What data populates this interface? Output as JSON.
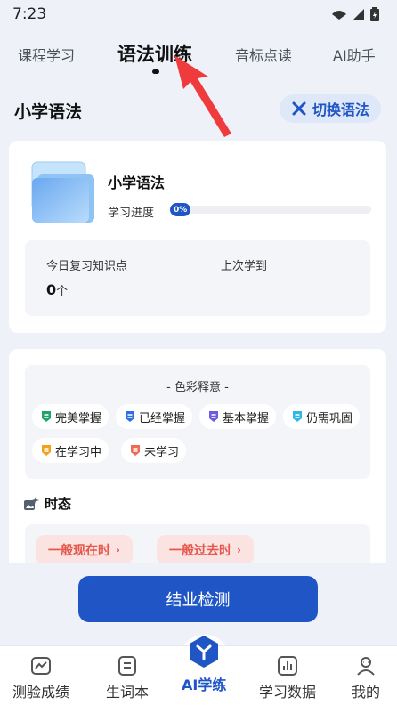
{
  "status_bar": {
    "time": "7:23"
  },
  "top_tabs": [
    {
      "label": "课程学习"
    },
    {
      "label": "语法训练"
    },
    {
      "label": "音标点读"
    },
    {
      "label": "AI助手"
    }
  ],
  "section": {
    "title": "小学语法",
    "switch_label": "切换语法"
  },
  "course": {
    "name": "小学语法",
    "progress_label": "学习进度",
    "progress_text": "0%",
    "progress_value": 0,
    "review_label": "今日复习知识点",
    "review_count": "0",
    "review_unit": "个",
    "last_label": "上次学到"
  },
  "legend": {
    "title": "- 色彩释意 -",
    "items": [
      {
        "label": "完美掌握",
        "color": "#1fa36b"
      },
      {
        "label": "已经掌握",
        "color": "#2f6fe6"
      },
      {
        "label": "基本掌握",
        "color": "#6a5ce0"
      },
      {
        "label": "仍需巩固",
        "color": "#2fb8e6"
      },
      {
        "label": "在学习中",
        "color": "#f2a21a"
      },
      {
        "label": "未学习",
        "color": "#ee6a55"
      }
    ]
  },
  "tense": {
    "title": "时态",
    "items": [
      {
        "label": "一般现在时"
      },
      {
        "label": "一般过去时"
      }
    ]
  },
  "complete_button": "结业检测",
  "bottom_nav": [
    {
      "label": "测验成绩",
      "icon": "chart-icon"
    },
    {
      "label": "生词本",
      "icon": "wordbook-icon"
    },
    {
      "label": "AI学练",
      "icon": "ai-practice-icon"
    },
    {
      "label": "学习数据",
      "icon": "bar-chart-icon"
    },
    {
      "label": "我的",
      "icon": "profile-icon"
    }
  ],
  "colors": {
    "primary": "#1f55c5",
    "accent_red": "#e5564b",
    "background": "#eef2f8"
  }
}
